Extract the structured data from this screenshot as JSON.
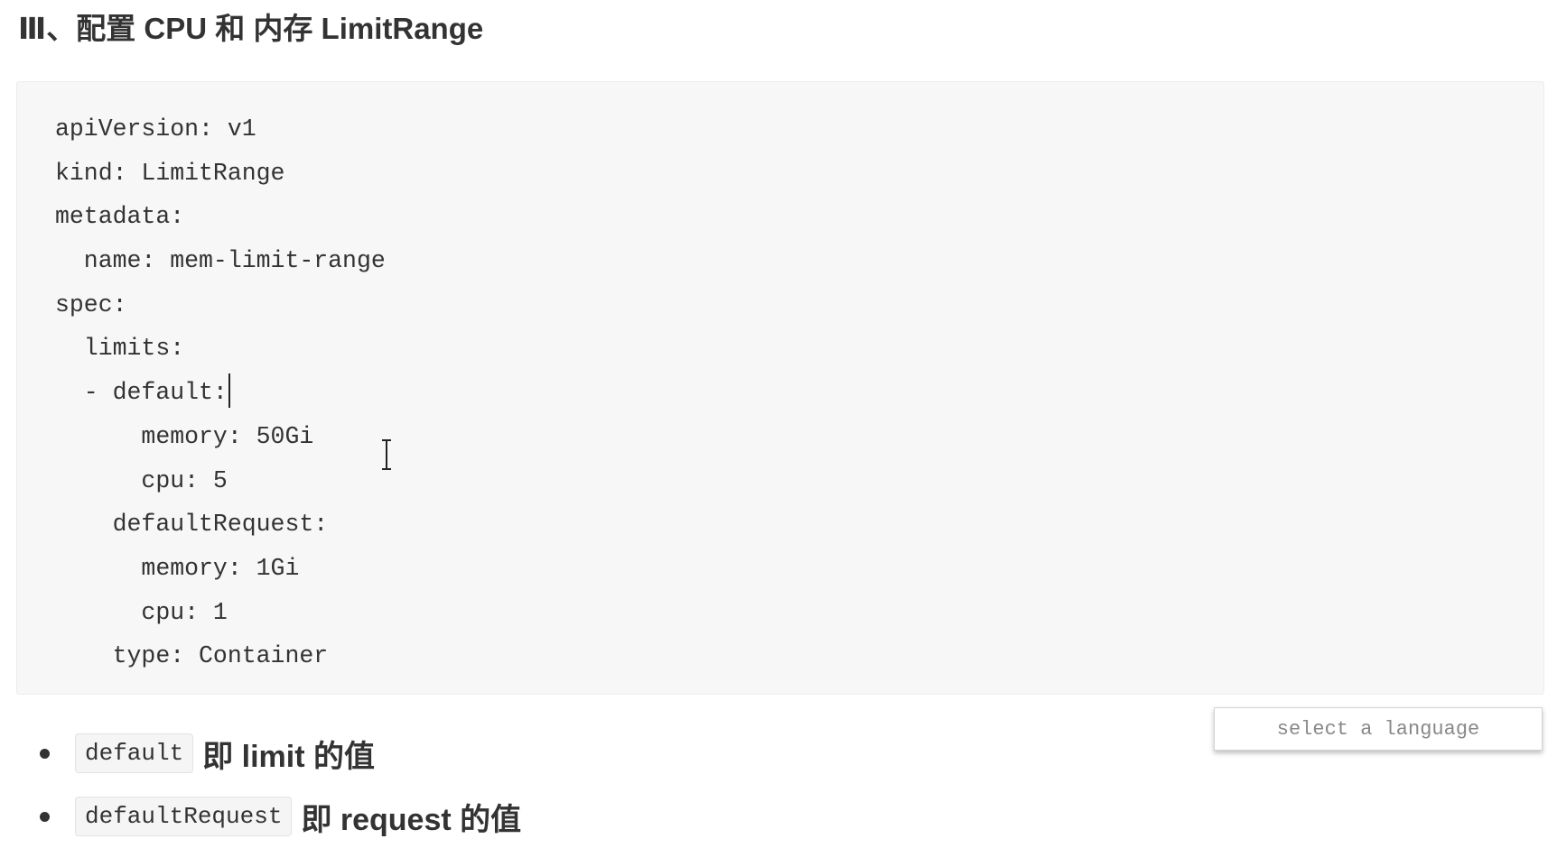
{
  "heading": "Ⅲ、配置 CPU 和 内存 LimitRange",
  "code_lines": [
    "apiVersion: v1",
    "kind: LimitRange",
    "metadata:",
    "  name: mem-limit-range",
    "spec:",
    "  limits:",
    "  - default:",
    "      memory: 50Gi",
    "      cpu: 5",
    "    defaultRequest:",
    "      memory: 1Gi",
    "      cpu: 1",
    "    type: Container"
  ],
  "language_selector": {
    "label": "select a language"
  },
  "bullets": [
    {
      "code": "default",
      "text": "即 limit 的值"
    },
    {
      "code": "defaultRequest",
      "text": "即 request 的值"
    }
  ]
}
